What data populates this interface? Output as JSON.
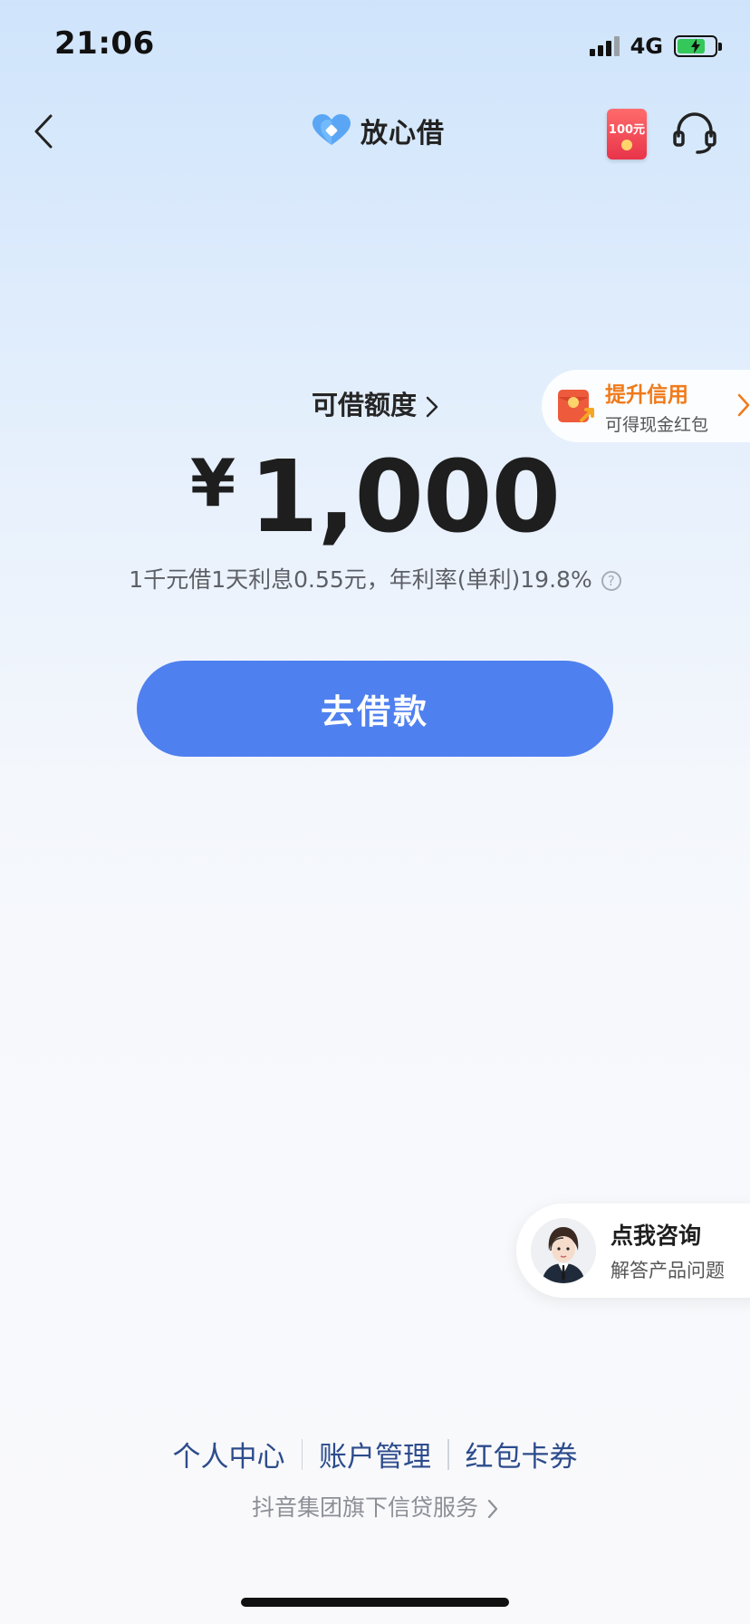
{
  "status_bar": {
    "time": "21:06",
    "network": "4G",
    "battery_level": 0.75
  },
  "header": {
    "logo_text": "放心借",
    "red_packet_amount": "100元"
  },
  "credit": {
    "label": "可借额度",
    "currency": "¥",
    "amount": "1,000",
    "rate_text": "1千元借1天利息0.55元，年利率(单利)19.8%",
    "help_symbol": "?"
  },
  "promo": {
    "title": "提升信用",
    "subtitle": "可得现金红包"
  },
  "borrow_button": {
    "label": "去借款"
  },
  "consult": {
    "title": "点我咨询",
    "subtitle": "解答产品问题"
  },
  "footer": {
    "links": [
      "个人中心",
      "账户管理",
      "红包卡券"
    ],
    "note": "抖音集团旗下信贷服务"
  },
  "colors": {
    "primary": "#4f80ef",
    "promo_accent": "#f07a1a",
    "link": "#2c4c8c"
  }
}
